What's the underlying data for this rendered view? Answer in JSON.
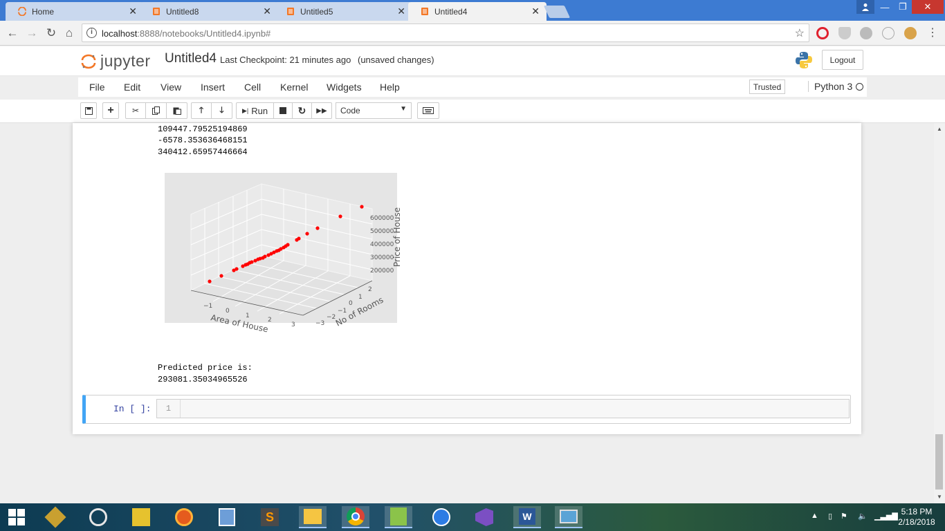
{
  "browser": {
    "tabs": [
      {
        "label": "Home",
        "active": false
      },
      {
        "label": "Untitled8",
        "active": false
      },
      {
        "label": "Untitled5",
        "active": false
      },
      {
        "label": "Untitled4",
        "active": true
      }
    ],
    "url_host": "localhost",
    "url_path": ":8888/notebooks/Untitled4.ipynb#"
  },
  "jupyter": {
    "logo_text": "jupyter",
    "notebook_name": "Untitled4",
    "checkpoint": "Last Checkpoint: 21 minutes ago",
    "save_status": "(unsaved changes)",
    "logout_label": "Logout",
    "menu": [
      "File",
      "Edit",
      "View",
      "Insert",
      "Cell",
      "Kernel",
      "Widgets",
      "Help"
    ],
    "trusted_label": "Trusted",
    "kernel_name": "Python 3",
    "run_label": "Run",
    "cell_type": "Code"
  },
  "output": {
    "lines_top": [
      "109447.79525194869",
      "-6578.353636468151",
      "340412.65957446664"
    ],
    "predicted_label": "Predicted price is:",
    "predicted_value": "293081.35034965526"
  },
  "plot": {
    "x_label": "Area of House",
    "y_label": "No of Rooms",
    "z_label": "Price of House",
    "x_ticks": [
      "−1",
      "0",
      "1",
      "2",
      "3"
    ],
    "y_ticks": [
      "−3",
      "−2",
      "−1",
      "0",
      "1",
      "2"
    ],
    "z_ticks": [
      "200000",
      "300000",
      "400000",
      "500000",
      "600000"
    ],
    "point_color": "#ff0000",
    "background": "#e5e5e5"
  },
  "input_cell": {
    "prompt": "In [ ]:",
    "line_number": "1"
  },
  "taskbar": {
    "time": "5:18 PM",
    "date": "2/18/2018"
  }
}
